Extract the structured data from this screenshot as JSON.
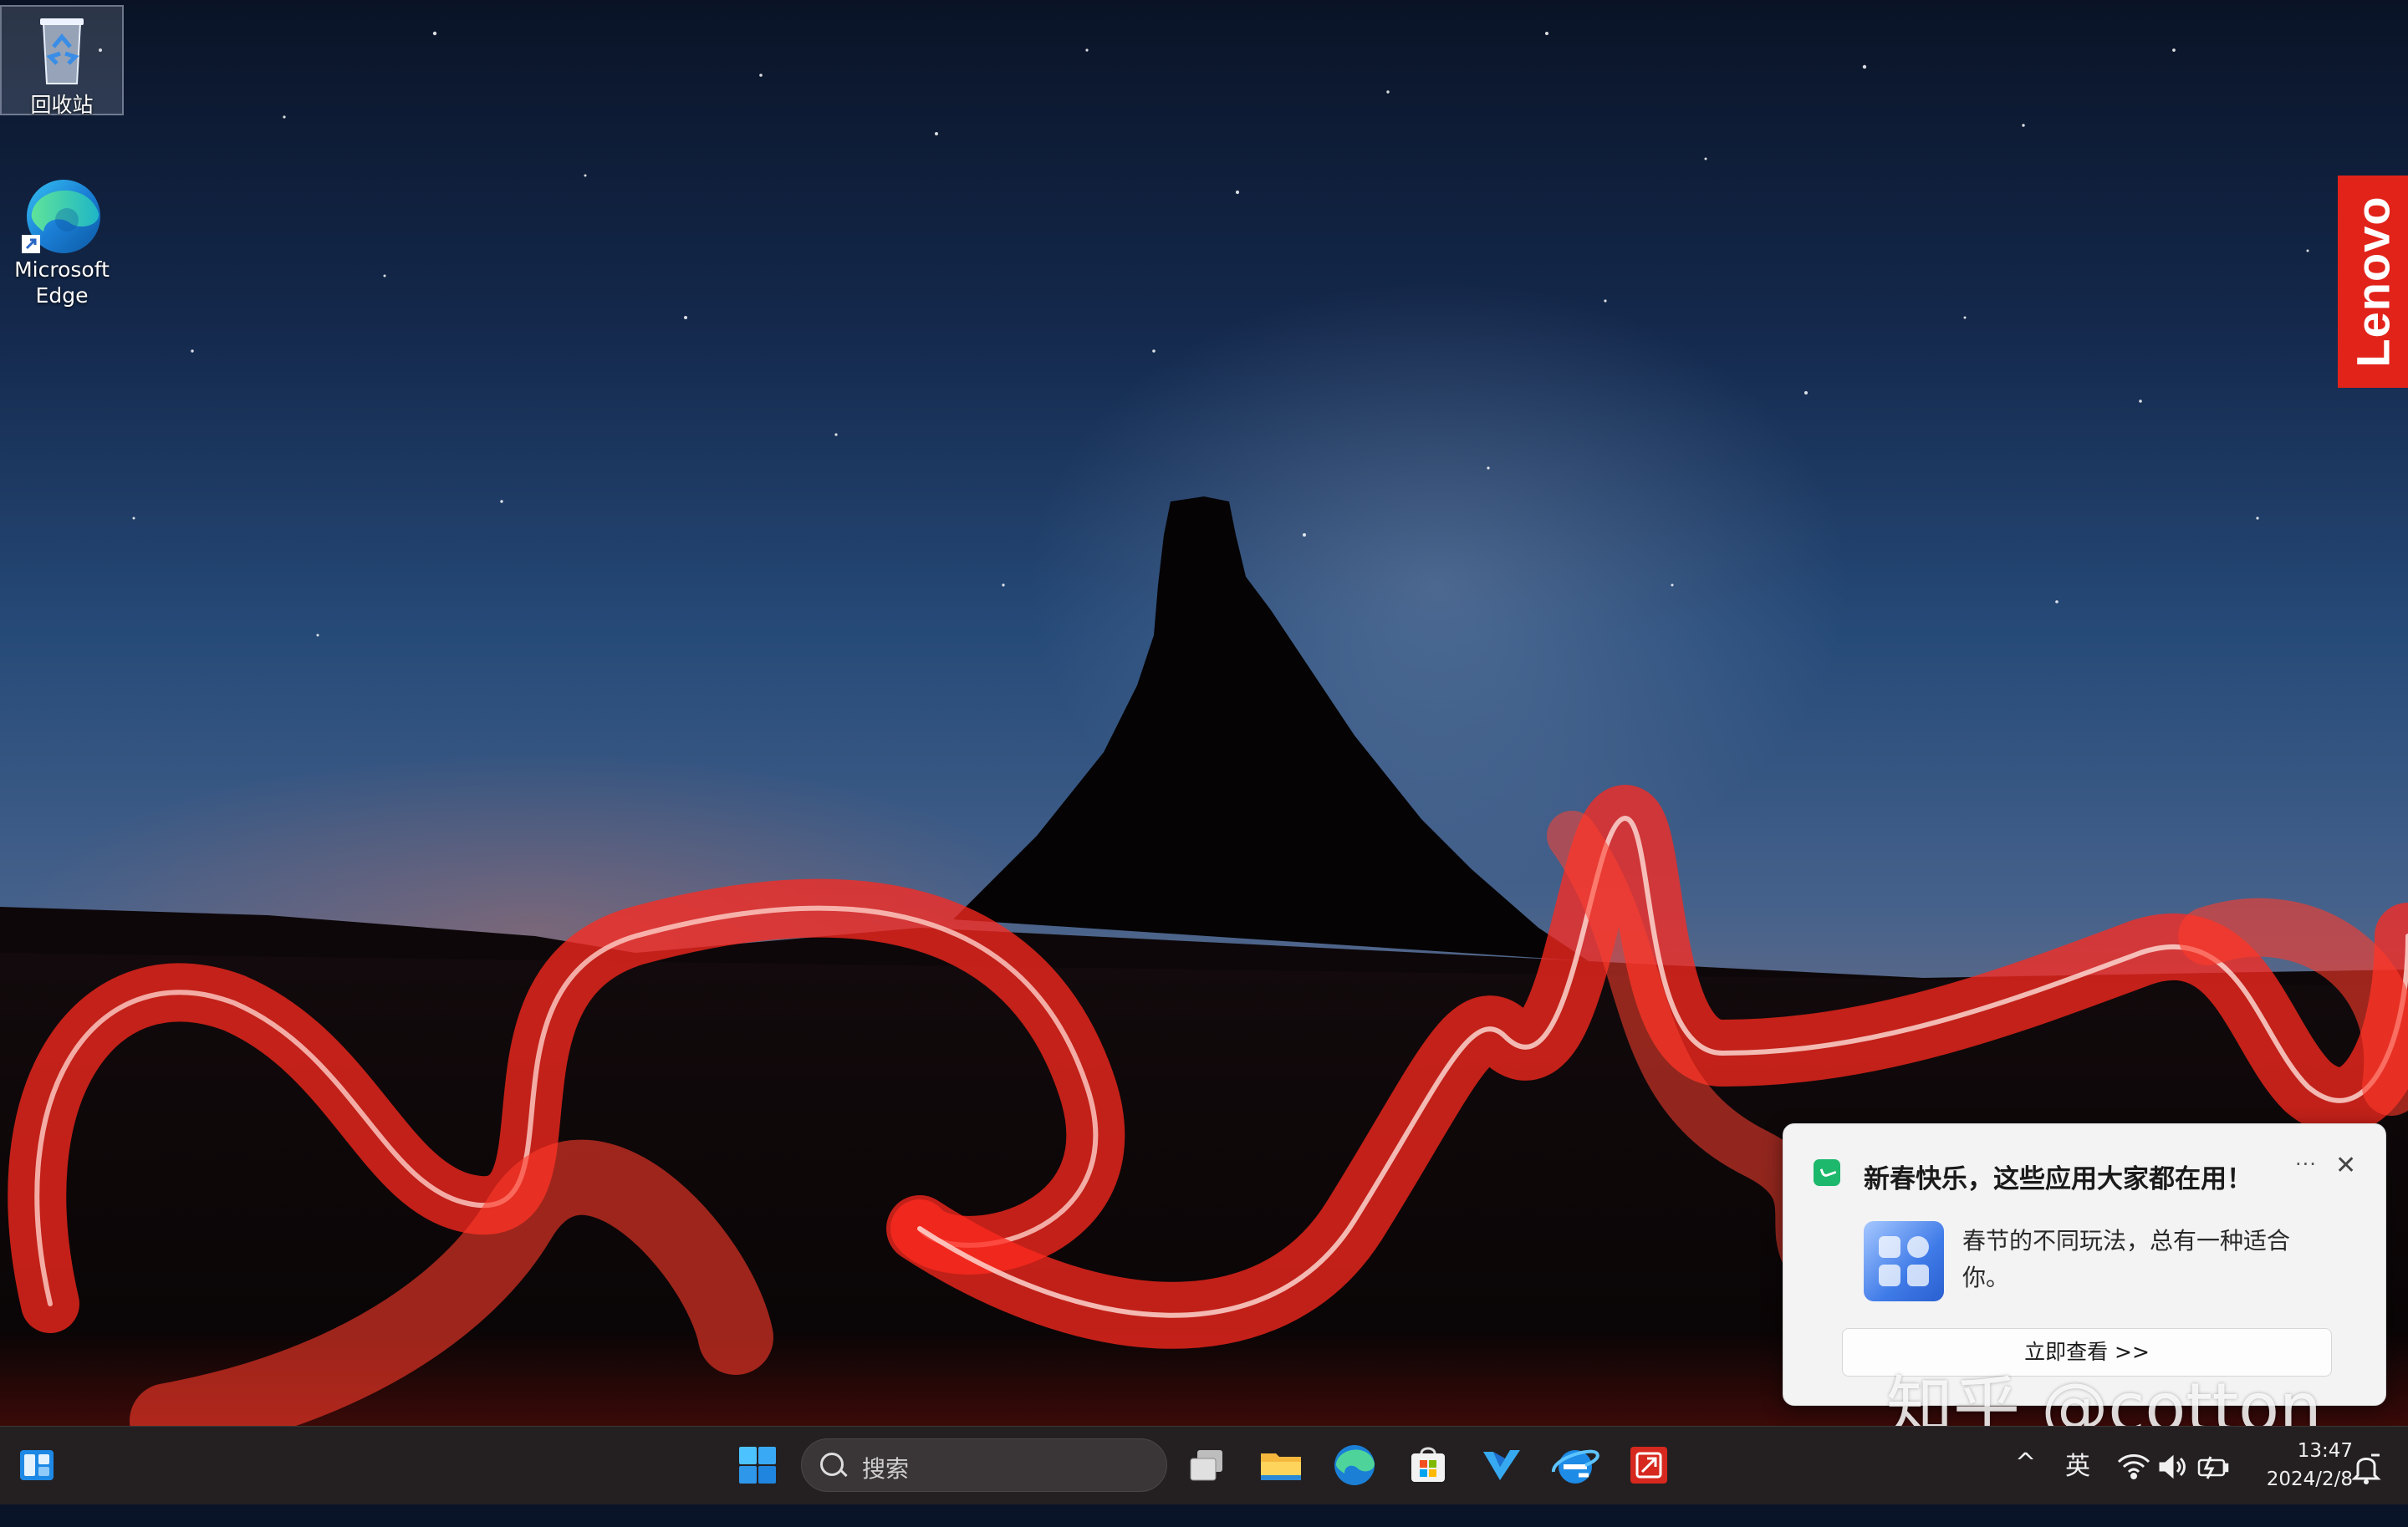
{
  "desktop": {
    "icons": [
      {
        "label": "回收站",
        "icon": "recycle-bin-icon"
      },
      {
        "label": "Microsoft Edge",
        "icon": "edge-icon"
      }
    ]
  },
  "lenovo_badge": {
    "text": "Lenovo",
    "color": "#e2231a"
  },
  "notification": {
    "app_icon": "wechat-green-icon",
    "title": "新春快乐，这些应用大家都在用！",
    "more_label": "···",
    "close_label": "✕",
    "body": "春节的不同玩法，总有一种适合你。",
    "action_label": "立即查看 >>"
  },
  "watermark": {
    "text": "知乎 @cotton"
  },
  "taskbar": {
    "search_placeholder": "搜索",
    "pinned_apps": [
      "task-view-icon",
      "file-explorer-icon",
      "edge-icon",
      "microsoft-store-icon",
      "v-app-icon",
      "ie-icon",
      "red-app-icon"
    ],
    "tray": {
      "chevron": "^",
      "ime": "英",
      "time": "13:47",
      "date": "2024/2/8"
    }
  },
  "colors": {
    "taskbar_bg": "#242021",
    "toast_bg": "#f3f3f3",
    "accent_red": "#e2231a"
  }
}
